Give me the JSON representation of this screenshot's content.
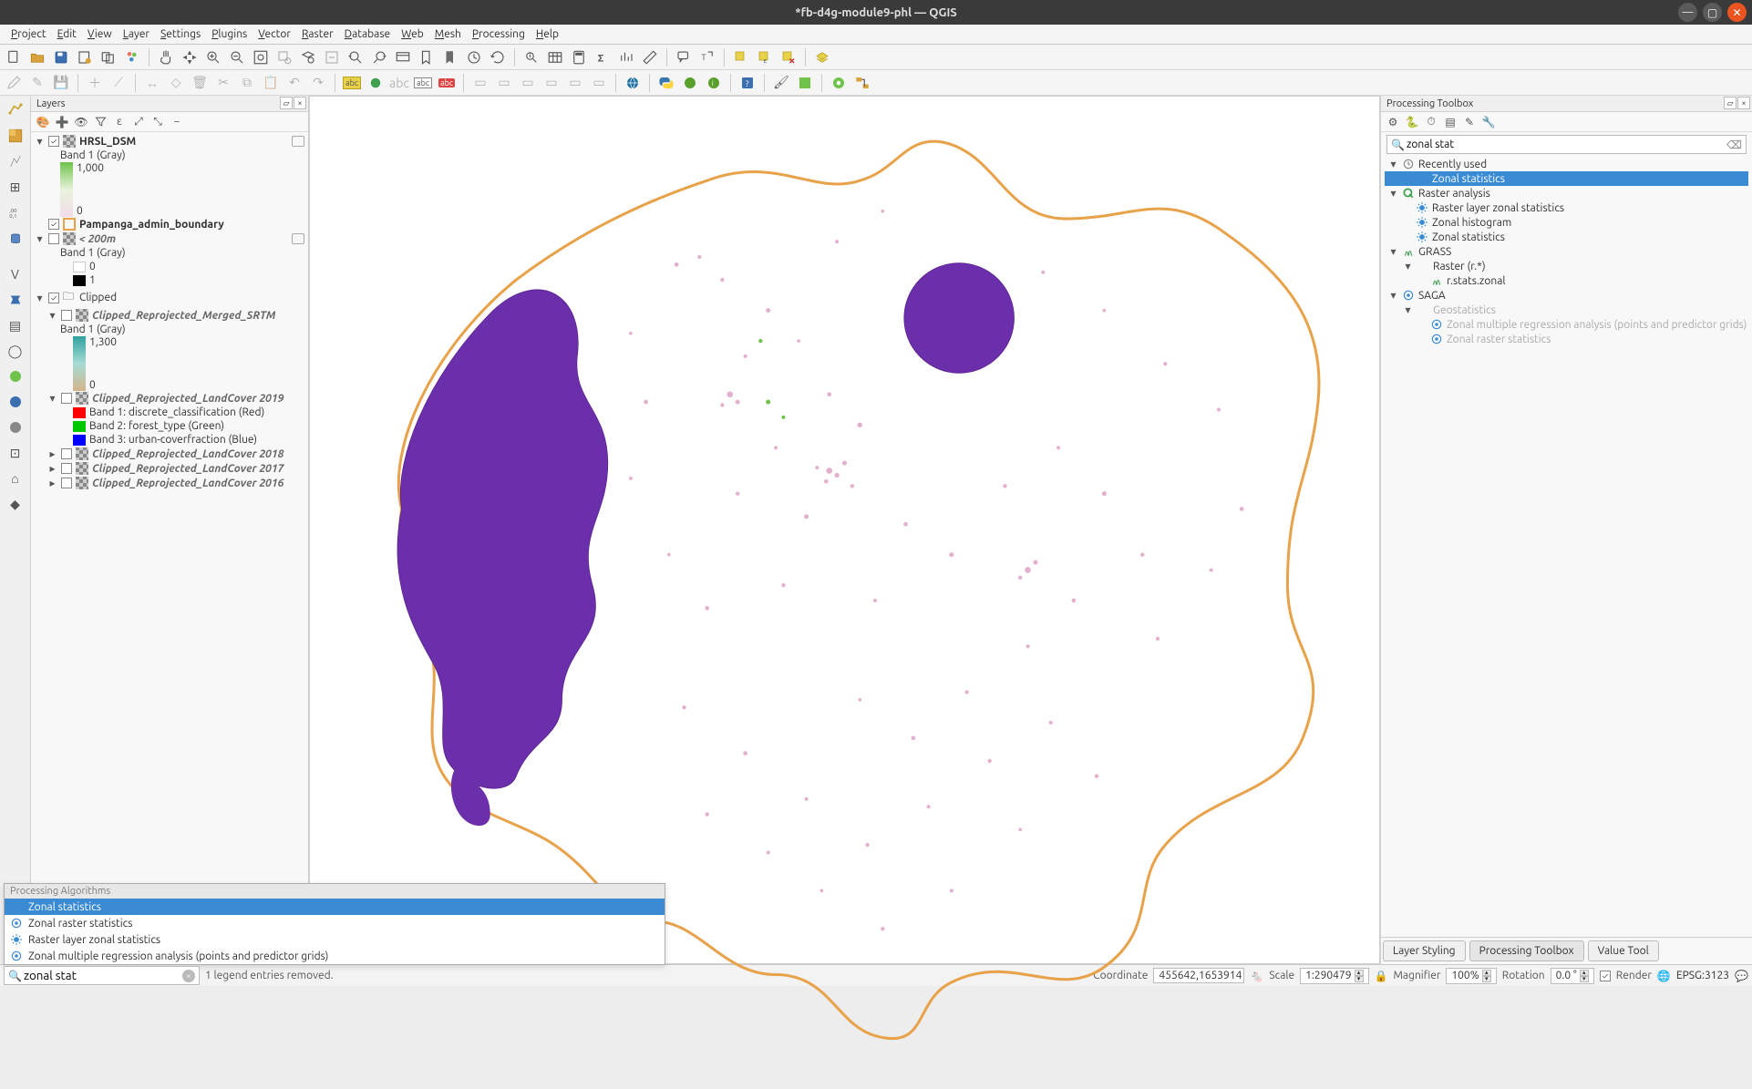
{
  "window": {
    "title": "*fb-d4g-module9-phl — QGIS"
  },
  "menu": [
    "Project",
    "Edit",
    "View",
    "Layer",
    "Settings",
    "Plugins",
    "Vector",
    "Raster",
    "Database",
    "Web",
    "Mesh",
    "Processing",
    "Help"
  ],
  "layers_panel": {
    "title": "Layers",
    "items": [
      {
        "name": "HRSL_DSM",
        "checked": true,
        "expanded": true,
        "band": "Band 1 (Gray)",
        "grad": {
          "top": "1,000",
          "bottom": "0"
        },
        "indicator": true
      },
      {
        "name": "Pampanga_admin_boundary",
        "checked": true
      },
      {
        "name": "< 200m",
        "checked": false,
        "italic": true,
        "band": "Band 1 (Gray)",
        "values": [
          "0",
          "1"
        ],
        "indicator": true
      },
      {
        "name": "Clipped",
        "checked": true,
        "expanded": true,
        "group": true,
        "children": [
          {
            "name": "Clipped_Reprojected_Merged_SRTM",
            "italic": true,
            "band": "Band 1 (Gray)",
            "grad": {
              "top": "1,300",
              "bottom": "0"
            }
          },
          {
            "name": "Clipped_Reprojected_LandCover 2019",
            "italic": true,
            "bands": [
              {
                "color": "#ff0000",
                "label": "Band 1: discrete_classification (Red)"
              },
              {
                "color": "#00c800",
                "label": "Band 2: forest_type (Green)"
              },
              {
                "color": "#0000ff",
                "label": "Band 3: urban-coverfraction (Blue)"
              }
            ]
          },
          {
            "name": "Clipped_Reprojected_LandCover 2018",
            "italic": true
          },
          {
            "name": "Clipped_Reprojected_LandCover 2017",
            "italic": true
          },
          {
            "name": "Clipped_Reprojected_LandCover 2016",
            "italic": true
          }
        ]
      }
    ]
  },
  "locator_popup": {
    "header": "Processing Algorithms",
    "items": [
      {
        "label": "Zonal statistics",
        "selected": true,
        "icon": "gear"
      },
      {
        "label": "Zonal raster statistics",
        "icon": "saga"
      },
      {
        "label": "Raster layer zonal statistics",
        "icon": "gear"
      },
      {
        "label": "Zonal multiple regression analysis (points and predictor grids)",
        "icon": "saga"
      }
    ]
  },
  "processing_panel": {
    "title": "Processing Toolbox",
    "search": "zonal stat",
    "tree": [
      {
        "label": "Recently used",
        "kind": "group",
        "icon": "clock",
        "children": [
          {
            "label": "Zonal statistics",
            "selected": true,
            "icon": "gear"
          }
        ]
      },
      {
        "label": "Raster analysis",
        "kind": "group",
        "icon": "qgis",
        "children": [
          {
            "label": "Raster layer zonal statistics",
            "icon": "gear"
          },
          {
            "label": "Zonal histogram",
            "icon": "gear"
          },
          {
            "label": "Zonal statistics",
            "icon": "gear"
          }
        ]
      },
      {
        "label": "GRASS",
        "kind": "group",
        "icon": "grass",
        "children": [
          {
            "label": "Raster (r.*)",
            "kind": "group",
            "children": [
              {
                "label": "r.stats.zonal",
                "icon": "grass"
              }
            ]
          }
        ]
      },
      {
        "label": "SAGA",
        "kind": "group",
        "icon": "saga",
        "children": [
          {
            "label": "Geostatistics",
            "kind": "group",
            "grey": true,
            "children": [
              {
                "label": "Zonal multiple regression analysis (points and predictor grids)",
                "icon": "saga",
                "grey": true
              },
              {
                "label": "Zonal raster statistics",
                "icon": "saga",
                "grey": true
              }
            ]
          }
        ]
      }
    ],
    "tabs": [
      "Layer Styling",
      "Processing Toolbox",
      "Value Tool"
    ],
    "active_tab": "Processing Toolbox"
  },
  "statusbar": {
    "locator_value": "zonal stat",
    "message": "1 legend entries removed.",
    "coordinate_label": "Coordinate",
    "coordinate": "455642,1653914",
    "scale_label": "Scale",
    "scale": "1:290479",
    "magnifier_label": "Magnifier",
    "magnifier": "100%",
    "rotation_label": "Rotation",
    "rotation": "0.0 °",
    "render_label": "Render",
    "crs": "EPSG:3123"
  },
  "colors": {
    "accent": "#3b8bd4",
    "purple": "#6c2fab",
    "boundary": "#e8a24a",
    "pink": "#e0a9c9"
  }
}
